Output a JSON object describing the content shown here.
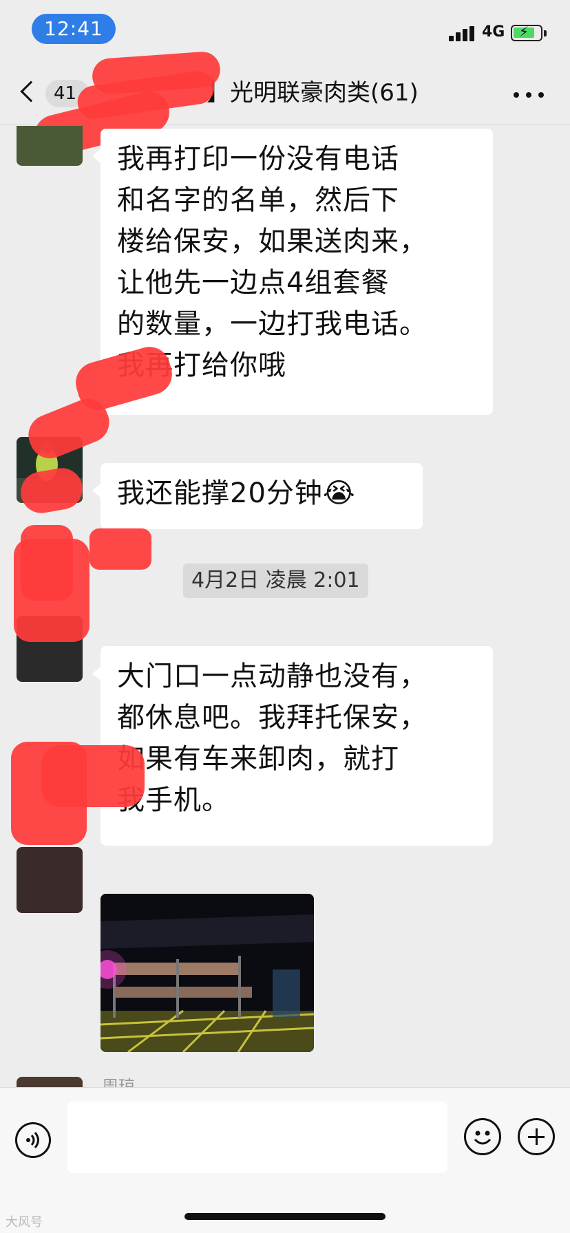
{
  "status_bar": {
    "time": "12:41",
    "network": "4G"
  },
  "nav": {
    "unread_count": "41",
    "title": "】光明联豪肉类(61)"
  },
  "messages": [
    {
      "text": "我再打印一份没有电话\n和名字的名单，然后下\n楼给保安，如果送肉来，\n让他先一边点4组套餐\n的数量，一边打我电话。\n我再打给你哦"
    },
    {
      "text": "我还能撑20分钟😭"
    },
    {
      "text": "大门口一点动静也没有，\n都休息吧。我拜托保安，\n如果有车来卸肉，就打\n我手机。"
    }
  ],
  "timestamp": "4月2日 凌晨 2:01",
  "partial_sender": "周琼",
  "input": {
    "value": ""
  },
  "watermark": "大风号"
}
